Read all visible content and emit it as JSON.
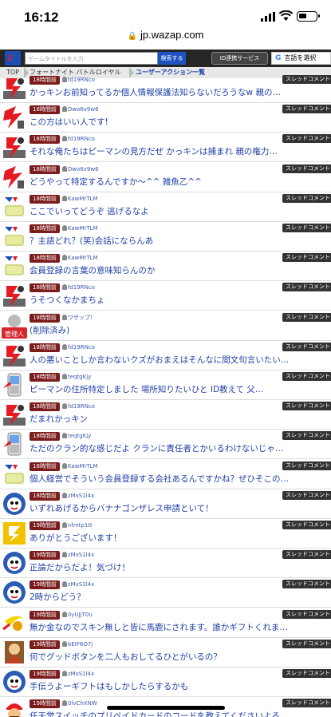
{
  "status": {
    "time": "16:12"
  },
  "browser": {
    "url": "jp.wazap.com"
  },
  "header": {
    "logo": "z",
    "search_placeholder": "ゲームタイトルを入力",
    "search_button": "検索する",
    "id_button": "ID連携サービス",
    "lang_button": "言語を選択",
    "lang_g": "G"
  },
  "breadcrumb": {
    "top": "TOP",
    "game": "フォートナイト バトルロイヤル",
    "current": "ユーザーアクション一覧"
  },
  "items": [
    {
      "time": "18時間前",
      "user": "fd19RNco",
      "msg": "かっキンお前知ってるか個人情報保護法知らないだろうなw 親の…",
      "tag": "スレッドコメント",
      "avatar": "red"
    },
    {
      "time": "18時間前",
      "user": "Dwo6v9w6",
      "msg": "この方はいい人です!",
      "tag": "スレッドコメント",
      "avatar": "red2"
    },
    {
      "time": "18時間前",
      "user": "fd19RNco",
      "msg": "それな俺たちはピーマンの見方だぜ かっキンは捕まれ 親の権力…",
      "tag": "スレッドコメント",
      "avatar": "red"
    },
    {
      "time": "18時間前",
      "user": "Dwo6v9w6",
      "msg": "どうやって特定するんですか〜^^ 雑魚乙^^",
      "tag": "スレッドコメント",
      "avatar": "red2"
    },
    {
      "time": "18時間前",
      "user": "KawMrTLM",
      "msg": "ここでいってどうぞ 逃げるなよ",
      "tag": "スレッドコメント",
      "avatar": "yellow"
    },
    {
      "time": "18時間前",
      "user": "KawMrTLM",
      "msg": "？主語どれ？(笑)会話にならんあ",
      "tag": "スレッドコメント",
      "avatar": "yellow"
    },
    {
      "time": "18時間前",
      "user": "KawMrTLM",
      "msg": "会員登録の言葉の意味知らんのか",
      "tag": "スレッドコメント",
      "avatar": "yellow"
    },
    {
      "time": "18時間前",
      "user": "fd19RNco",
      "msg": "うそつくなかまちょ",
      "tag": "スレッドコメント",
      "avatar": "red"
    },
    {
      "time": "18時間前",
      "user": "ワザップ!",
      "msg": "(削除済み)",
      "tag": "スレッドコメント",
      "avatar": "admin"
    },
    {
      "time": "18時間前",
      "user": "fd19RNco",
      "msg": "人の悪いことしか言わないクズがおまえはそんなに間文句言いたい…",
      "tag": "スレッドコメント",
      "avatar": "red"
    },
    {
      "time": "18時間前",
      "user": "teqtgKjy",
      "msg": "ピーマンの住所特定しました 場所知りたいひと ID教えて 父…",
      "tag": "スレッドコメント",
      "avatar": "phone"
    },
    {
      "time": "18時間前",
      "user": "fd19RNco",
      "msg": "だまれかっキン",
      "tag": "スレッドコメント",
      "avatar": "red"
    },
    {
      "time": "18時間前",
      "user": "teqtgKjy",
      "msg": "ただのクラン的な感じだよ クランに責任者とかいるわけないじゃ…",
      "tag": "スレッドコメント",
      "avatar": "phone"
    },
    {
      "time": "18時間前",
      "user": "KawMrTLM",
      "msg": "個人経営でそういう会員登録する会社あるんですかね？ぜひそこの…",
      "tag": "スレッドコメント",
      "avatar": "yellow"
    },
    {
      "time": "18時間前",
      "user": "zMxS1l4x",
      "msg": "いずれあげるからバナナゴンザレス申請といて！",
      "tag": "スレッドコメント",
      "avatar": "blue"
    },
    {
      "time": "19時間前",
      "user": "nfmtp1tt",
      "msg": "ありがとうございます！",
      "tag": "スレッドコメント",
      "avatar": "gold"
    },
    {
      "time": "19時間前",
      "user": "zMxS1l4x",
      "msg": "正論だからだよ！気づけ！",
      "tag": "スレッドコメント",
      "avatar": "blue"
    },
    {
      "time": "19時間前",
      "user": "zMxS1l4x",
      "msg": "2時からどう？",
      "tag": "スレッドコメント",
      "avatar": "blue"
    },
    {
      "time": "19時間前",
      "user": "0yUJjT0u",
      "msg": "無か金なのでスキン無しと皆に馬鹿にされます。誰かギフトくれま…",
      "tag": "スレッドコメント",
      "avatar": "banana"
    },
    {
      "time": "19時間前",
      "user": "bEIF6O7j",
      "msg": "何でグッドボタンを二人もおしてるひとがいるの？",
      "tag": "スレッドコメント",
      "avatar": "warrior"
    },
    {
      "time": "19時間前",
      "user": "zMxS1l4x",
      "msg": "手伝うよーギフトはもしかしたらするかも",
      "tag": "スレッドコメント",
      "avatar": "blue"
    },
    {
      "time": "19時間前",
      "user": "0lvChXNW",
      "msg": "任天堂スイッチのプリペイドカードのコードを教えてくださいよろ…",
      "tag": "スレッドコメント",
      "avatar": "mario"
    }
  ]
}
